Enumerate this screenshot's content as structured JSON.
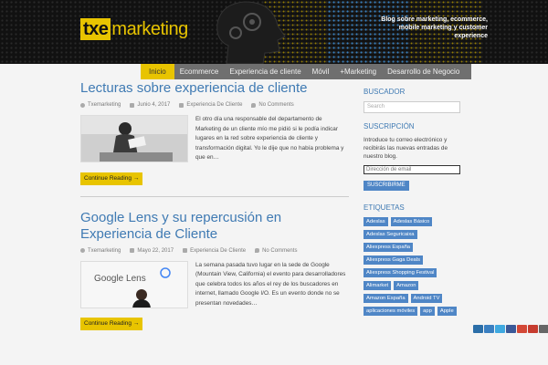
{
  "header": {
    "logo_box": "txe",
    "logo_rest": "marketing",
    "tagline": "Blog sobre marketing, ecommerce, mobile marketing y customer experience"
  },
  "nav": {
    "items": [
      "Inicio",
      "Ecommerce",
      "Experiencia de cliente",
      "Móvil",
      "+Marketing",
      "Desarrollo de Negocio"
    ]
  },
  "posts": [
    {
      "title": "Lecturas sobre experiencia de cliente",
      "author": "Txemarketing",
      "date": "Junio 4, 2017",
      "category": "Experiencia De Cliente",
      "comments": "No Comments",
      "excerpt": "El otro día una responsable del departamento de Marketing de un cliente mío me pidió si le podía indicar lugares en la red sobre experiencia de cliente y transformación digital. Yo le dije que no había problema y que en…",
      "button": "Continue Reading →"
    },
    {
      "title": "Google Lens y su repercusión en Experiencia de Cliente",
      "author": "Txemarketing",
      "date": "Mayo 22, 2017",
      "category": "Experiencia De Cliente",
      "comments": "No Comments",
      "excerpt": "La semana pasada tuvo lugar en la sede de Google (Mountain View, California) el evento para desarrolladores que celebra todos los años el rey de los buscadores en internet, llamado Google I/O. Es un evento donde no se presentan novedades…",
      "thumb_text": "Google Lens",
      "button": "Continue Reading →"
    }
  ],
  "sidebar": {
    "search_title": "BUSCADOR",
    "search_placeholder": "Search",
    "subscribe_title": "SUSCRIPCIÓN",
    "subscribe_text": "Introduce tu correo electrónico y recibirás las nuevas entradas de nuestro blog.",
    "email_placeholder": "Dirección de email",
    "subscribe_button": "SUSCRIBIRME",
    "tags_title": "ETIQUETAS",
    "tags": [
      "Adeslas",
      "Adeslas Básico",
      "Adeslas Seguricaixa",
      "Aliexpress España",
      "Aliexpress Gaga Deals",
      "Aliexpress Shopping Festival",
      "Alimarket",
      "Amazon",
      "Amazon España",
      "Android TV",
      "aplicaciones móviles",
      "app",
      "Apple"
    ]
  },
  "share": {
    "icons": [
      "linkedin-icon",
      "delicious-icon",
      "twitter-icon",
      "facebook-icon",
      "googleplus-icon",
      "gmail-icon",
      "print-icon"
    ],
    "colors": [
      "#2b6ea8",
      "#3a7fc1",
      "#3fa9e0",
      "#3b5998",
      "#d34836",
      "#c63c2f",
      "#666666"
    ]
  },
  "colors": {
    "accent": "#e8c400",
    "link": "#3f7ab3",
    "tag": "#4f86c6"
  }
}
